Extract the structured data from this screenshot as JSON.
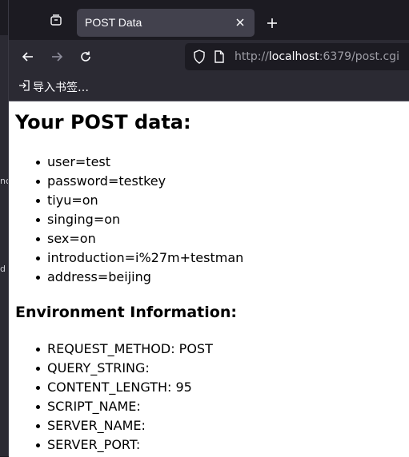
{
  "browser": {
    "tab_title": "POST Data",
    "url_scheme": "http://",
    "url_host": "localhost",
    "url_rest": ":6379/post.cgi",
    "bookmark_label": "导入书签…"
  },
  "background": {
    "fragment_1": "nc",
    "fragment_2": "d"
  },
  "page": {
    "heading": "Your POST data:",
    "post_items": [
      "user=test",
      "password=testkey",
      "tiyu=on",
      "singing=on",
      "sex=on",
      "introduction=i%27m+testman",
      "address=beijing"
    ],
    "env_heading": "Environment Information:",
    "env_items": [
      "REQUEST_METHOD: POST",
      "QUERY_STRING:",
      "CONTENT_LENGTH: 95",
      "SCRIPT_NAME:",
      "SERVER_NAME:",
      "SERVER_PORT:"
    ]
  },
  "icons": {
    "tab_list": "tab-list-icon",
    "close": "close-icon",
    "new_tab": "plus-icon",
    "back": "back-arrow-icon",
    "forward": "forward-arrow-icon",
    "reload": "reload-icon",
    "tracking": "shield-icon",
    "page_info": "page-icon",
    "import": "import-icon"
  }
}
